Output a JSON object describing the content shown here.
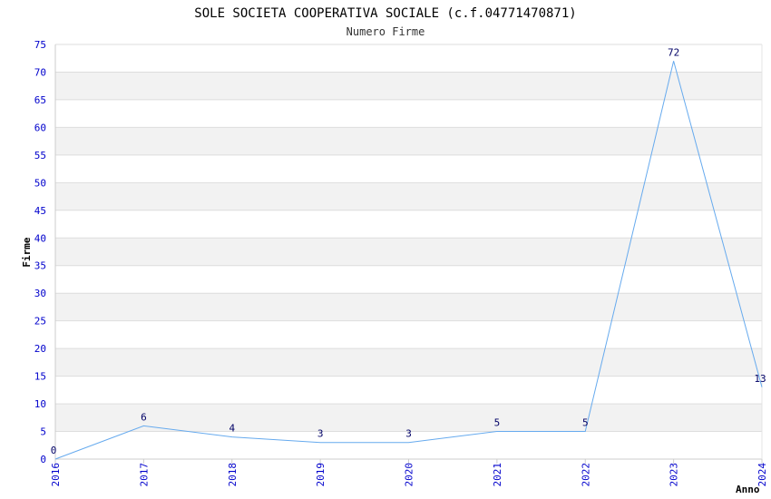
{
  "chart_data": {
    "type": "line",
    "title": "SOLE SOCIETA COOPERATIVA SOCIALE (c.f.04771470871)",
    "subtitle": "Numero Firme",
    "xlabel": "Anno",
    "ylabel": "Firme",
    "x": [
      "2016",
      "2017",
      "2018",
      "2019",
      "2020",
      "2021",
      "2022",
      "2023",
      "2024"
    ],
    "series": [
      {
        "values": [
          0,
          6,
          4,
          3,
          3,
          5,
          5,
          72,
          13
        ]
      }
    ],
    "ylim": [
      0,
      75
    ],
    "yticks": [
      0,
      5,
      10,
      15,
      20,
      25,
      30,
      35,
      40,
      45,
      50,
      55,
      60,
      65,
      70,
      75
    ],
    "grid": "horizontal alternating bands",
    "legend": "none"
  },
  "colors": {
    "line": "#66aaee",
    "band": "#f2f2f2",
    "grid": "#dddddd",
    "tick_text": "#0000cc",
    "data_label": "#000066"
  }
}
